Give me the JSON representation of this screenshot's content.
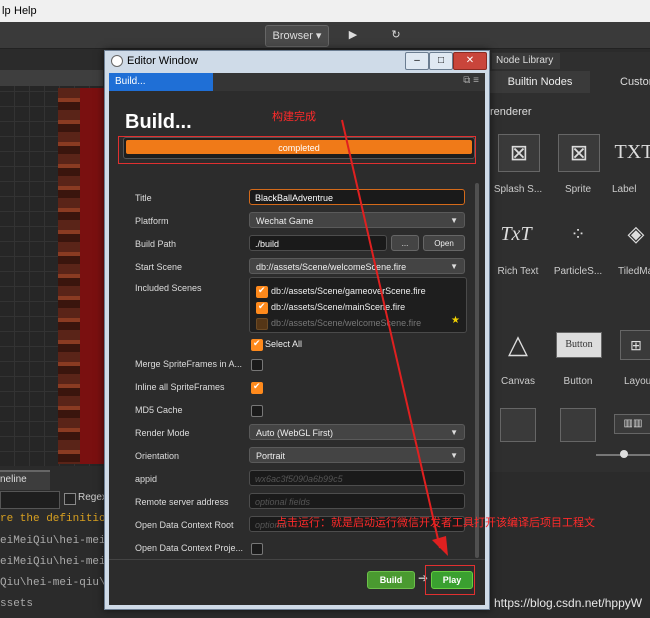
{
  "menubar": {
    "items": [
      "lp",
      "Help"
    ]
  },
  "toolbar": {
    "browser_label": "Browser",
    "play_icon": "play-icon",
    "refresh_icon": "refresh-icon"
  },
  "right_panel": {
    "tab_node_library": "Node Library",
    "tab_builtin": "Builtin Nodes",
    "tab_custom": "Custom",
    "section_heading": "renderer",
    "nodes": [
      {
        "label": "Splash S...",
        "icon": "splash-sprite-icon"
      },
      {
        "label": "Sprite",
        "icon": "sprite-icon"
      },
      {
        "label": "Label",
        "icon": "label-icon",
        "glyph": "TXT"
      },
      {
        "label": "Rich Text",
        "icon": "richtext-icon",
        "glyph": "TxT"
      },
      {
        "label": "ParticleS...",
        "icon": "particle-icon"
      },
      {
        "label": "TiledMa",
        "icon": "tiledmap-icon"
      },
      {
        "label": "Canvas",
        "icon": "canvas-icon"
      },
      {
        "label": "Button",
        "icon": "button-icon",
        "glyph": "Button"
      },
      {
        "label": "Layou",
        "icon": "layout-icon"
      }
    ]
  },
  "console": {
    "timeline_tab": "neline",
    "regex_label": "Regex",
    "lines": [
      "re the definition",
      "eiMeiQiu\\hei-mei-qiu",
      "eiMeiQiu\\hei-mei-qiu",
      "Qiu\\hei-mei-qiu\\m",
      "ssets"
    ]
  },
  "editor_window": {
    "title": "Editor Window",
    "panel_tab": "Build...",
    "heading": "Build...",
    "progress": {
      "label": "completed",
      "fraction": 1.0
    },
    "fields": {
      "title": {
        "label": "Title",
        "value": "BlackBallAdventrue"
      },
      "platform": {
        "label": "Platform",
        "value": "Wechat Game"
      },
      "build_path": {
        "label": "Build Path",
        "value": "./build",
        "browse": "...",
        "open": "Open"
      },
      "start_scene": {
        "label": "Start Scene",
        "value": "db://assets/Scene/welcomeScene.fire"
      },
      "included_scenes": {
        "label": "Included Scenes",
        "scenes": [
          "db://assets/Scene/gameoverScene.fire",
          "db://assets/Scene/mainScene.fire",
          "db://assets/Scene/welcomeScene.fire"
        ],
        "select_all": "Select All"
      },
      "merge_spriteframes": {
        "label": "Merge SpriteFrames in A...",
        "checked": false
      },
      "inline_spriteframes": {
        "label": "Inline all SpriteFrames",
        "checked": true
      },
      "md5_cache": {
        "label": "MD5 Cache",
        "checked": false
      },
      "render_mode": {
        "label": "Render Mode",
        "value": "Auto (WebGL First)"
      },
      "orientation": {
        "label": "Orientation",
        "value": "Portrait"
      },
      "appid": {
        "label": "appid",
        "placeholder": "wx6ac3f5090a6b99c5"
      },
      "remote_server": {
        "label": "Remote server address",
        "placeholder": "optional fields"
      },
      "open_data_root": {
        "label": "Open Data Context Root",
        "placeholder": "optional"
      },
      "open_data_project": {
        "label": "Open Data Context Proje...",
        "checked": false
      }
    },
    "buttons": {
      "build": "Build",
      "play": "Play"
    }
  },
  "annotations": {
    "build_done": "构建完成",
    "play_note": "点击运行：就是启动运行微信开发者工具打开该编译后项目工程文"
  },
  "watermark": "https://blog.csdn.net/hppyW",
  "colors": {
    "progress": "#f07a18",
    "accent_tab": "#1f6fd6",
    "annotation": "#e02020",
    "build_button": "#4a9a30",
    "checkbox": "#ff8a1c"
  }
}
